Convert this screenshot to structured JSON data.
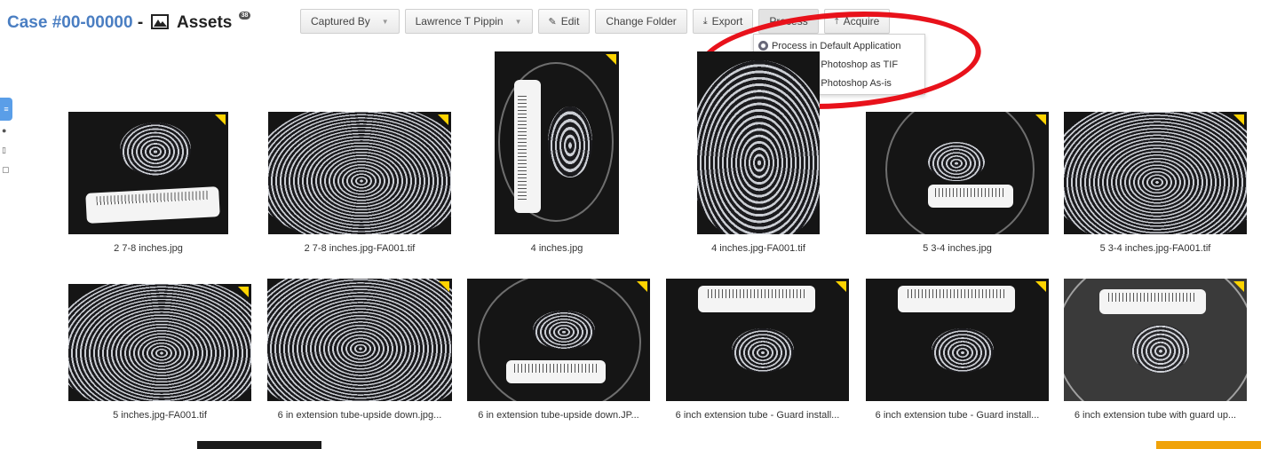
{
  "header": {
    "case_label": "Case #00-00000",
    "dash": "-",
    "section_icon": "image-icon",
    "section_label": "Assets",
    "count": "38"
  },
  "toolbar": {
    "captured_by": "Captured By",
    "user": "Lawrence T Pippin",
    "edit": "Edit",
    "change_folder": "Change Folder",
    "export": "Export",
    "process": "Process",
    "acquire": "Acquire"
  },
  "process_menu": {
    "items": [
      {
        "label": "Process in Default Application",
        "icon": "gear-icon"
      },
      {
        "label": "Process in Photoshop as TIF",
        "icon": "photoshop-icon"
      },
      {
        "label": "Process in Photoshop As-is",
        "icon": "photoshop-icon"
      }
    ]
  },
  "highlight_color": "#e8121b",
  "accent_color": "#4a7ec2",
  "assets": [
    {
      "name": "2 7-8 inches.jpg"
    },
    {
      "name": "2 7-8 inches.jpg-FA001.tif"
    },
    {
      "name": "4 inches.jpg"
    },
    {
      "name": "4 inches.jpg-FA001.tif"
    },
    {
      "name": "5 3-4 inches.jpg"
    },
    {
      "name": "5 3-4 inches.jpg-FA001.tif"
    },
    {
      "name": "5 inches.jpg-FA001.tif"
    },
    {
      "name": "6 in extension tube-upside down.jpg..."
    },
    {
      "name": "6 in extension tube-upside down.JP..."
    },
    {
      "name": "6 inch extension tube - Guard install..."
    },
    {
      "name": "6 inch extension tube - Guard install..."
    },
    {
      "name": "6 inch extension tube with guard up..."
    }
  ]
}
